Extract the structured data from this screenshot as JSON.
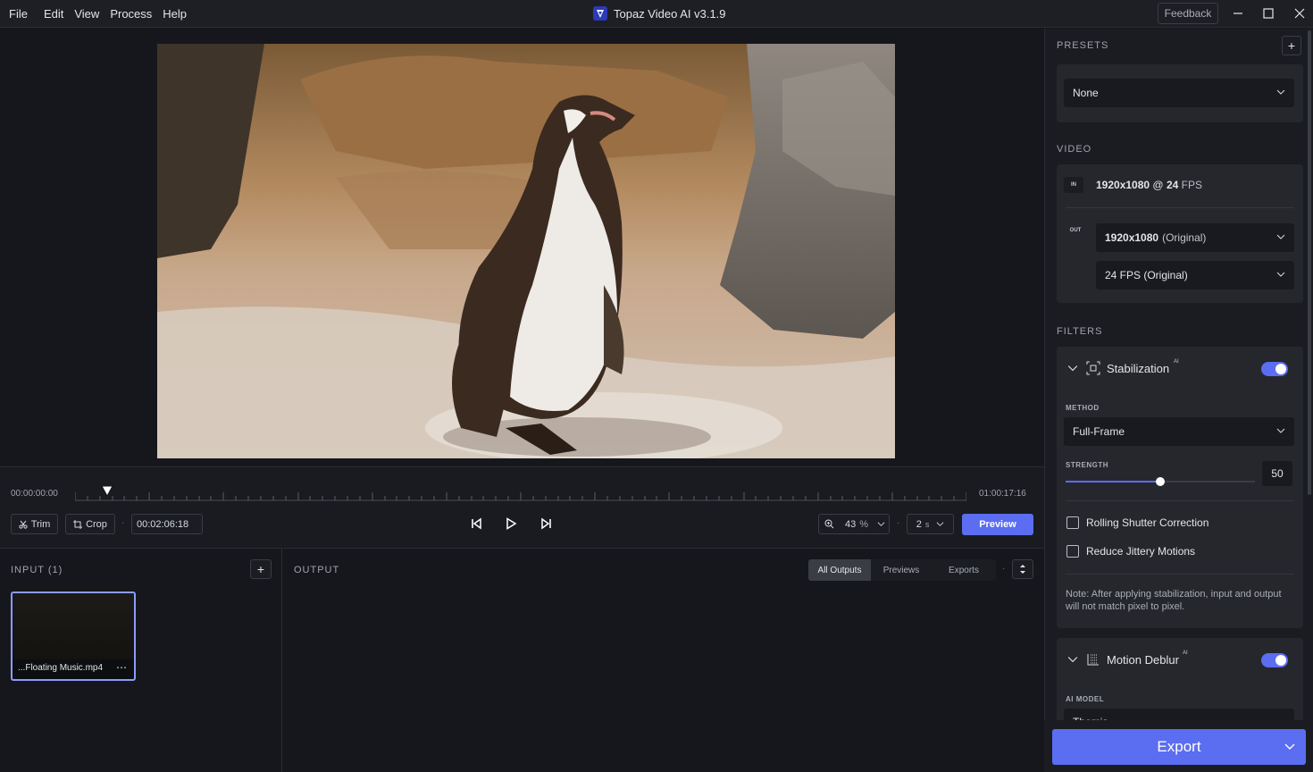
{
  "menu": {
    "file": "File",
    "edit": "Edit",
    "view": "View",
    "process": "Process",
    "help": "Help"
  },
  "app": {
    "title": "Topaz Video AI  v3.1.9",
    "feedback": "Feedback"
  },
  "timeline": {
    "start": "00:00:00:00",
    "end": "01:00:17:16",
    "trim": "Trim",
    "crop": "Crop",
    "current": "00:02:06:18",
    "zoom": "43",
    "zoom_unit": "%",
    "step": "2",
    "step_unit": "s",
    "preview": "Preview",
    "playhead_fraction": 0.036
  },
  "input": {
    "label": "INPUT (1)",
    "filename": "...Floating Music.mp4",
    "more": "⋯"
  },
  "output": {
    "label": "OUTPUT",
    "tabs": [
      "All Outputs",
      "Previews",
      "Exports"
    ],
    "dot": "·"
  },
  "presets": {
    "label": "PRESETS",
    "value": "None"
  },
  "video": {
    "label": "VIDEO",
    "in_badge": "IN",
    "out_badge": "OUT",
    "in_res": "1920x1080",
    "in_at": "@",
    "in_fps": "24",
    "in_fps_unit": "FPS",
    "out_res": "1920x1080",
    "out_res_note": "(Original)",
    "out_fps": "24 FPS (Original)"
  },
  "filters": {
    "label": "FILTERS",
    "stabilization": {
      "title": "Stabilization",
      "ai": "AI",
      "enabled": true,
      "method_label": "METHOD",
      "method": "Full-Frame",
      "strength_label": "STRENGTH",
      "strength": "50",
      "strength_value": 50,
      "rolling": "Rolling Shutter Correction",
      "jittery": "Reduce Jittery Motions",
      "note": "Note: After applying stabilization, input and output will not match pixel to pixel."
    },
    "deblur": {
      "title": "Motion Deblur",
      "ai": "AI",
      "enabled": true,
      "model_label": "AI MODEL",
      "model": "Themis"
    }
  },
  "export": "Export",
  "colors": {
    "accent": "#5b6df0",
    "selection": "#8c9bff"
  }
}
